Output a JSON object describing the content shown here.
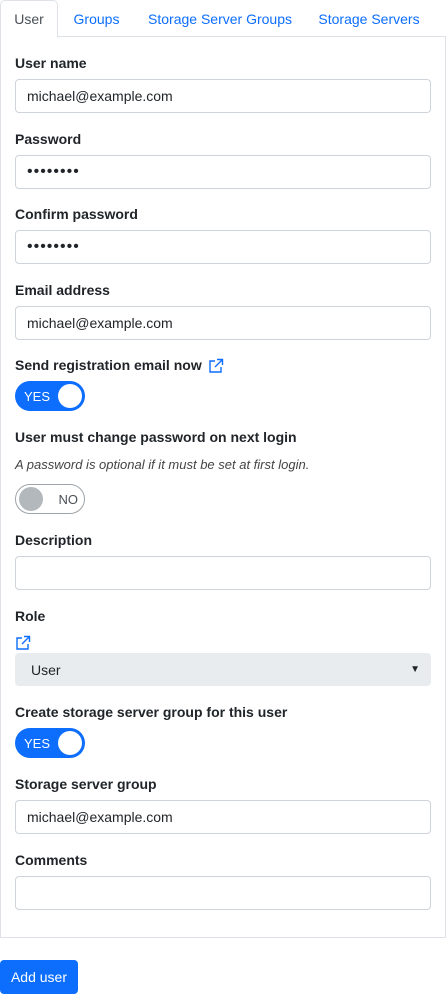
{
  "tabs": [
    {
      "label": "User",
      "active": true
    },
    {
      "label": "Groups",
      "active": false
    },
    {
      "label": "Storage Server Groups",
      "active": false
    },
    {
      "label": "Storage Servers",
      "active": false
    }
  ],
  "form": {
    "username": {
      "label": "User name",
      "value": "michael@example.com"
    },
    "password": {
      "label": "Password",
      "value": "••••••••"
    },
    "confirm_password": {
      "label": "Confirm password",
      "value": "••••••••"
    },
    "email": {
      "label": "Email address",
      "value": "michael@example.com"
    },
    "send_registration": {
      "label": "Send registration email now",
      "state": "YES"
    },
    "must_change_password": {
      "label": "User must change password on next login",
      "hint": "A password is optional if it must be set at first login.",
      "state": "NO"
    },
    "description": {
      "label": "Description",
      "value": ""
    },
    "role": {
      "label": "Role",
      "selected": "User"
    },
    "create_group": {
      "label": "Create storage server group for this user",
      "state": "YES"
    },
    "storage_group": {
      "label": "Storage server group",
      "value": "michael@example.com"
    },
    "comments": {
      "label": "Comments",
      "value": ""
    }
  },
  "add_user_label": "Add user",
  "colors": {
    "accent": "#0d6efd",
    "border": "#dee2e6",
    "select_bg": "#e9ecef"
  }
}
